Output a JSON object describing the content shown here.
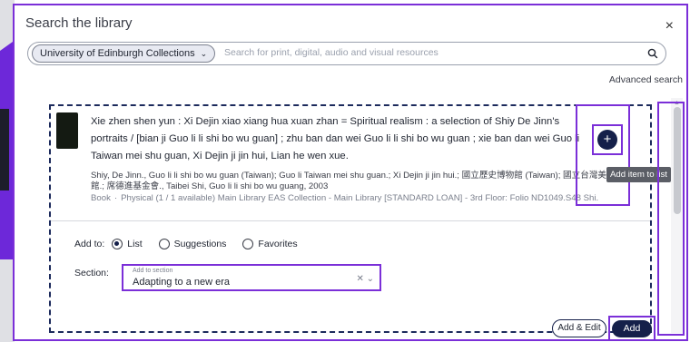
{
  "modal": {
    "title": "Search the library",
    "close_glyph": "×"
  },
  "search": {
    "scope_label": "University of Edinburgh Collections",
    "scope_chevron": "⌄",
    "placeholder": "Search for print, digital, audio and visual resources",
    "advanced_label": "Advanced search"
  },
  "result": {
    "title": "Xie zhen shen yun : Xi Dejin xiao xiang hua xuan zhan = Spiritual realism : a selection of Shiy De Jinn's portraits / [bian ji Guo li li shi bo wu guan] ; zhu ban dan wei Guo li li shi bo wu guan ; xie ban dan wei Guo li Taiwan mei shu guan, Xi Dejin ji jin hui, Lian he wen xue.",
    "authors": "Shiy, De Jinn., Guo li li shi bo wu guan (Taiwan); Guo li Taiwan mei shu guan.; Xi Dejin ji jin hui.; 國立歷史博物館 (Taiwan); 國立台灣美術館.; 席德進基金會., Taibei Shi, Guo li li shi bo wu guang, 2003",
    "type": "Book",
    "availability": "Physical (1 / 1 available) Main Library EAS Collection - Main Library [STANDARD LOAN] - 3rd Floor: Folio ND1049.S48 Shi.",
    "tooltip": "Add item to list",
    "add_icon_glyph": "+"
  },
  "add_to": {
    "label": "Add to:",
    "options": [
      "List",
      "Suggestions",
      "Favorites"
    ],
    "selected": "List"
  },
  "section": {
    "label": "Section:",
    "floating_label": "Add to section",
    "value": "Adapting to a new era",
    "controls": "✕ ⌄"
  },
  "buttons": {
    "add_edit": "Add & Edit",
    "add": "Add"
  },
  "colors": {
    "accent": "#7b2fd8",
    "primary": "#15204a"
  }
}
